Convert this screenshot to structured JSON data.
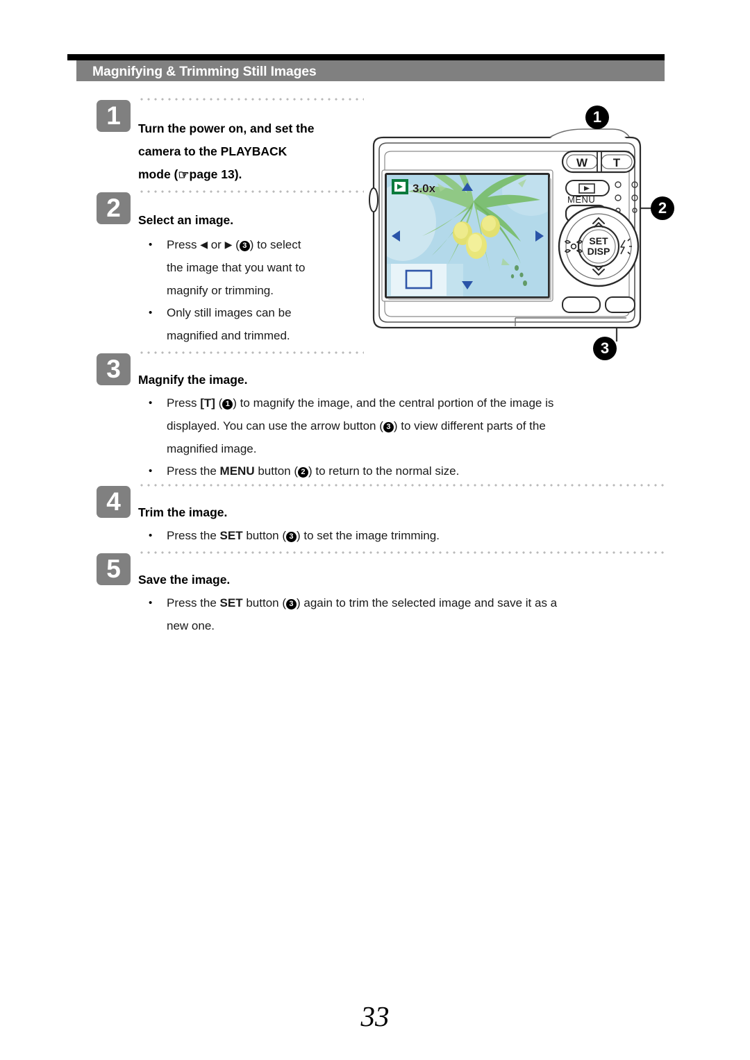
{
  "document": {
    "header_title": "Magnifying & Trimming Still Images",
    "page_number": "33"
  },
  "steps": [
    {
      "number": "1",
      "heading_line1": "Turn the power on, and set the",
      "heading_line2": "camera to the PLAYBACK",
      "heading_line3_pre": "mode (",
      "heading_hand_icon": "☞",
      "heading_line3_post": "page 13)."
    },
    {
      "number": "2",
      "heading": "Select an image.",
      "bullets": [
        {
          "pre": "Press",
          "left_arrow": "◀",
          "mid": "or",
          "right_arrow": "▶",
          "callout": "3",
          "post": ") to select",
          "line2": "the image that you want to",
          "line3": "magnify or trimming."
        },
        {
          "line1": "Only still images can be",
          "line2": "magnified and trimmed."
        }
      ]
    },
    {
      "number": "3",
      "heading": "Magnify the image.",
      "bullets": [
        {
          "seg1": "Press ",
          "key1": "[T]",
          "seg2": " (",
          "callout1": "1",
          "seg3": ") to magnify the image, and the central portion of the image is",
          "line2_pre": "displayed. You can use the arrow button (",
          "callout2": "3",
          "line2_post": ") to view different parts of the",
          "line3": "magnified image."
        },
        {
          "seg1": "Press the ",
          "key1": "MENU",
          "seg2": " button (",
          "callout1": "2",
          "seg3": ") to return to the normal size."
        }
      ]
    },
    {
      "number": "4",
      "heading": "Trim the image.",
      "bullets": [
        {
          "seg1": "Press the ",
          "key1": "SET",
          "seg2": " button (",
          "callout1": "3",
          "seg3": ") to set the image trimming."
        }
      ]
    },
    {
      "number": "5",
      "heading": "Save the image.",
      "bullets": [
        {
          "seg1": "Press the ",
          "key1": "SET",
          "seg2": " button (",
          "callout1": "3",
          "seg3": ") again to trim the selected image and save it as a",
          "line2": "new one."
        }
      ]
    }
  ],
  "illustration": {
    "alt": "Rear view of a digital camera",
    "callouts": [
      {
        "label": "1",
        "target": "zoom-lever-T"
      },
      {
        "label": "2",
        "target": "menu-button"
      },
      {
        "label": "3",
        "target": "arrow-button-pad"
      }
    ],
    "lcd": {
      "playback_icon": "▶",
      "zoom_ratio": "3.0x",
      "arrow_up": "▲",
      "arrow_down": "▼",
      "arrow_left": "◀",
      "arrow_right": "▶",
      "scene": "palm tree with coconuts against sky"
    },
    "buttons": {
      "zoom_wide": "W",
      "zoom_tele": "T",
      "playback": "▶",
      "menu": "MENU",
      "set_line1": "SET",
      "set_line2": "DISP",
      "pad_up": "∧",
      "pad_down": "∨",
      "pad_left_icon": "macro-flower-icon",
      "pad_right_icon": "flash-bolt-icon"
    }
  },
  "colors": {
    "banner": "#808080",
    "badge": "#808080",
    "rule": "#000000",
    "lcd_sky": "#b7dcec",
    "lcd_leaf": "#8cc878",
    "lcd_fruit": "#e3e06a",
    "lcd_icon_green": "#0a7a3c",
    "lcd_arrow_blue": "#2a54a8",
    "dot_gray": "#b9b9b9"
  }
}
